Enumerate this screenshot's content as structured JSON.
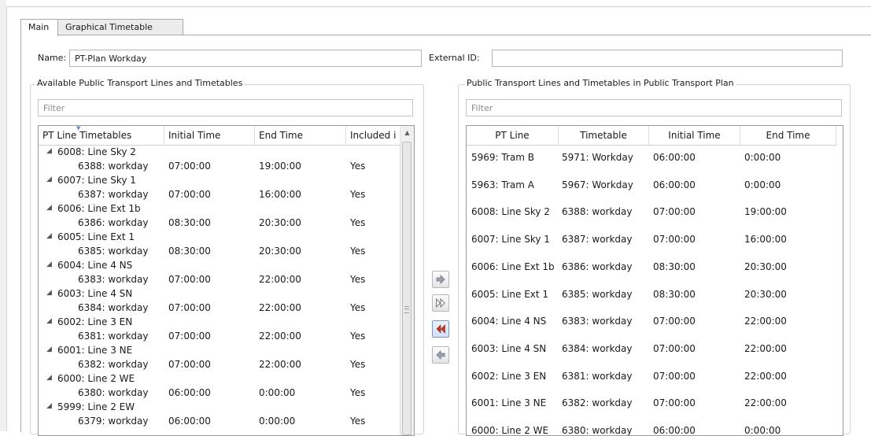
{
  "tabs": [
    {
      "label": "Main",
      "active": true
    },
    {
      "label": "Graphical Timetable",
      "active": false
    }
  ],
  "form": {
    "name_label": "Name:",
    "name_value": "PT-Plan Workday",
    "external_id_label": "External ID:",
    "external_id_value": ""
  },
  "available": {
    "group_title": "Available Public Transport Lines and Timetables",
    "filter_placeholder": "Filter",
    "columns": [
      "PT Line Timetables",
      "Initial Time",
      "End Time",
      "Included i"
    ],
    "lines": [
      {
        "line": "6008: Line Sky 2",
        "timetable": "6388: workday",
        "initial": "07:00:00",
        "end": "19:00:00",
        "included": "Yes"
      },
      {
        "line": "6007: Line Sky 1",
        "timetable": "6387: workday",
        "initial": "07:00:00",
        "end": "16:00:00",
        "included": "Yes"
      },
      {
        "line": "6006: Line Ext 1b",
        "timetable": "6386: workday",
        "initial": "08:30:00",
        "end": "20:30:00",
        "included": "Yes"
      },
      {
        "line": "6005: Line Ext 1",
        "timetable": "6385: workday",
        "initial": "08:30:00",
        "end": "20:30:00",
        "included": "Yes"
      },
      {
        "line": "6004: Line 4 NS",
        "timetable": "6383: workday",
        "initial": "07:00:00",
        "end": "22:00:00",
        "included": "Yes"
      },
      {
        "line": "6003: Line 4 SN",
        "timetable": "6384: workday",
        "initial": "07:00:00",
        "end": "22:00:00",
        "included": "Yes"
      },
      {
        "line": "6002: Line 3 EN",
        "timetable": "6381: workday",
        "initial": "07:00:00",
        "end": "22:00:00",
        "included": "Yes"
      },
      {
        "line": "6001: Line 3 NE",
        "timetable": "6382: workday",
        "initial": "07:00:00",
        "end": "22:00:00",
        "included": "Yes"
      },
      {
        "line": "6000: Line 2 WE",
        "timetable": "6380: workday",
        "initial": "06:00:00",
        "end": "0:00:00",
        "included": "Yes"
      },
      {
        "line": "5999: Line 2 EW",
        "timetable": "6379: workday",
        "initial": "06:00:00",
        "end": "0:00:00",
        "included": "Yes"
      }
    ]
  },
  "plan": {
    "group_title": "Public Transport Lines and Timetables in Public Transport Plan",
    "filter_placeholder": "Filter",
    "columns": [
      "PT Line",
      "Timetable",
      "Initial Time",
      "End Time"
    ],
    "rows": [
      {
        "line": "5969: Tram B",
        "timetable": "5971: Workday",
        "initial": "06:00:00",
        "end": "0:00:00"
      },
      {
        "line": "5963: Tram A",
        "timetable": "5967: Workday",
        "initial": "06:00:00",
        "end": "0:00:00"
      },
      {
        "line": "6008: Line Sky 2",
        "timetable": "6388: workday",
        "initial": "07:00:00",
        "end": "19:00:00"
      },
      {
        "line": "6007: Line Sky 1",
        "timetable": "6387: workday",
        "initial": "07:00:00",
        "end": "16:00:00"
      },
      {
        "line": "6006: Line Ext 1b",
        "timetable": "6386: workday",
        "initial": "08:30:00",
        "end": "20:30:00"
      },
      {
        "line": "6005: Line Ext 1",
        "timetable": "6385: workday",
        "initial": "08:30:00",
        "end": "20:30:00"
      },
      {
        "line": "6004: Line 4 NS",
        "timetable": "6383: workday",
        "initial": "07:00:00",
        "end": "22:00:00"
      },
      {
        "line": "6003: Line 4 SN",
        "timetable": "6384: workday",
        "initial": "07:00:00",
        "end": "22:00:00"
      },
      {
        "line": "6002: Line 3 EN",
        "timetable": "6381: workday",
        "initial": "07:00:00",
        "end": "22:00:00"
      },
      {
        "line": "6001: Line 3 NE",
        "timetable": "6382: workday",
        "initial": "07:00:00",
        "end": "22:00:00"
      },
      {
        "line": "6000: Line 2 WE",
        "timetable": "6380: workday",
        "initial": "06:00:00",
        "end": "0:00:00"
      }
    ]
  },
  "transfer_buttons": [
    {
      "name": "add-selected-button",
      "icon": "arrow-right-icon"
    },
    {
      "name": "add-all-button",
      "icon": "double-arrow-right-icon"
    },
    {
      "name": "remove-all-button",
      "icon": "double-arrow-left-icon"
    },
    {
      "name": "remove-selected-button",
      "icon": "arrow-left-icon"
    }
  ],
  "colors": {
    "arrow_fill": "#9aa3ad",
    "double_left_fill": "#c23a22",
    "pressed_border": "#7a9ac6"
  }
}
